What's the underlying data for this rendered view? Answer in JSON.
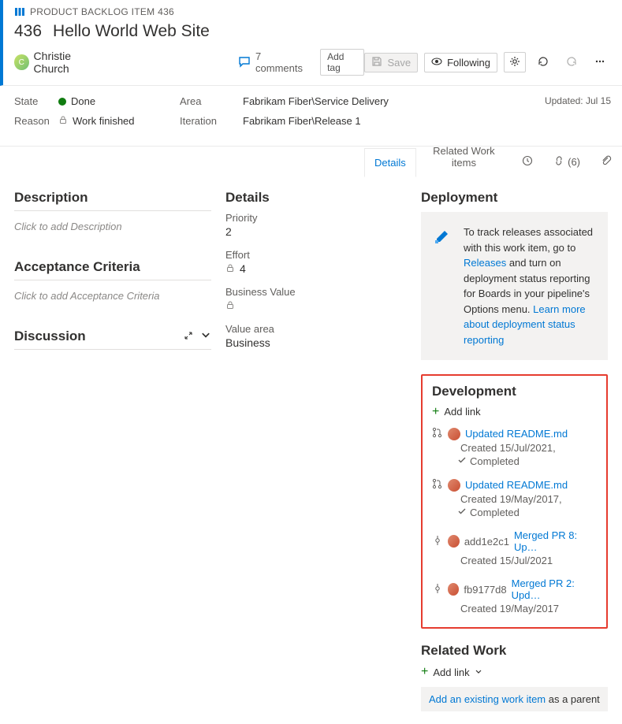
{
  "header": {
    "type_label": "PRODUCT BACKLOG ITEM 436",
    "id": "436",
    "title": "Hello World Web Site",
    "assignee": "Christie Church",
    "comments_count": "7 comments",
    "add_tag": "Add tag",
    "save": "Save",
    "following": "Following"
  },
  "fields": {
    "state_label": "State",
    "state_value": "Done",
    "reason_label": "Reason",
    "reason_value": "Work finished",
    "area_label": "Area",
    "area_value": "Fabrikam Fiber\\Service Delivery",
    "iteration_label": "Iteration",
    "iteration_value": "Fabrikam Fiber\\Release 1",
    "updated": "Updated: Jul 15"
  },
  "tabs": {
    "details": "Details",
    "related": "Related Work items",
    "links_count": "(6)"
  },
  "description": {
    "heading": "Description",
    "placeholder": "Click to add Description"
  },
  "acceptance": {
    "heading": "Acceptance Criteria",
    "placeholder": "Click to add Acceptance Criteria"
  },
  "discussion": {
    "heading": "Discussion"
  },
  "detailsPanel": {
    "heading": "Details",
    "priority_label": "Priority",
    "priority_value": "2",
    "effort_label": "Effort",
    "effort_value": "4",
    "bv_label": "Business Value",
    "va_label": "Value area",
    "va_value": "Business"
  },
  "deployment": {
    "heading": "Deployment",
    "text1": "To track releases associated with this work item, go to ",
    "link1": "Releases",
    "text2": " and turn on deployment status reporting for Boards in your pipeline's Options menu. ",
    "link2": "Learn more about deployment status reporting"
  },
  "development": {
    "heading": "Development",
    "add_link": "Add link",
    "items": [
      {
        "type": "pr",
        "title": "Updated README.md",
        "created": "Created 15/Jul/2021,",
        "status": "Completed"
      },
      {
        "type": "pr",
        "title": "Updated README.md",
        "created": "Created 19/May/2017,",
        "status": "Completed"
      },
      {
        "type": "commit",
        "hash": "add1e2c1",
        "title": "Merged PR 8: Up…",
        "created": "Created 15/Jul/2021"
      },
      {
        "type": "commit",
        "hash": "fb9177d8",
        "title": "Merged PR 2: Upd…",
        "created": "Created 19/May/2017"
      }
    ]
  },
  "related": {
    "heading": "Related Work",
    "add_link": "Add link",
    "existing_link": "Add an existing work item",
    "existing_rest": " as a parent"
  }
}
